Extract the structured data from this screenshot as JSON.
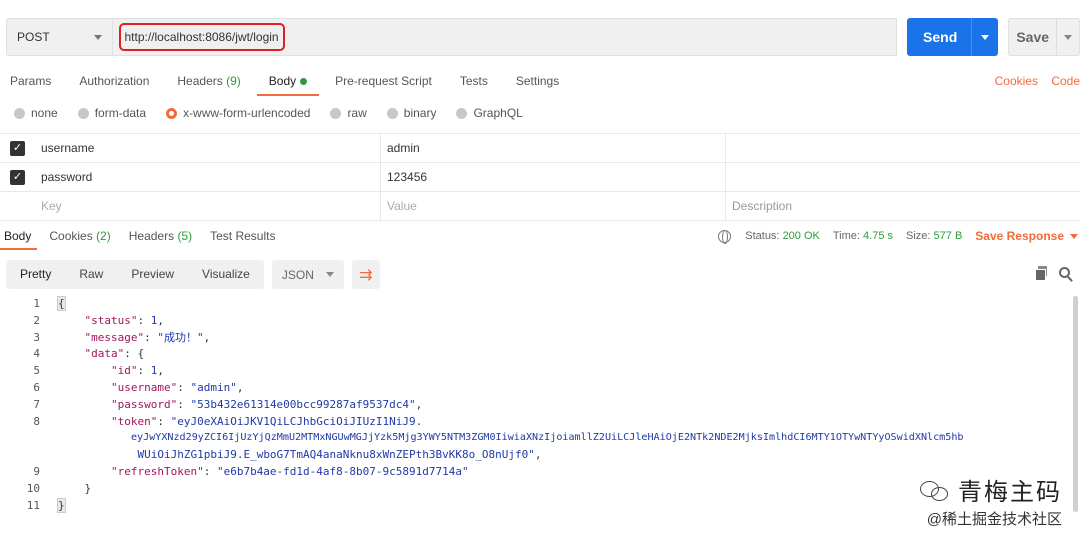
{
  "request": {
    "method": "POST",
    "url": "http://localhost:8086/jwt/login",
    "send_label": "Send",
    "save_label": "Save"
  },
  "request_tabs": {
    "params": "Params",
    "authorization": "Authorization",
    "headers": "Headers",
    "headers_count": "(9)",
    "body": "Body",
    "prerequest": "Pre-request Script",
    "tests": "Tests",
    "settings": "Settings",
    "cookies": "Cookies",
    "code": "Code"
  },
  "body_types": {
    "none": "none",
    "form_data": "form-data",
    "urlencoded": "x-www-form-urlencoded",
    "raw": "raw",
    "binary": "binary",
    "graphql": "GraphQL"
  },
  "params": {
    "rows": [
      {
        "key": "username",
        "value": "admin"
      },
      {
        "key": "password",
        "value": "123456"
      }
    ],
    "placeholder": {
      "key": "Key",
      "value": "Value",
      "description": "Description"
    }
  },
  "response_tabs": {
    "body": "Body",
    "cookies": "Cookies",
    "cookies_count": "(2)",
    "headers": "Headers",
    "headers_count": "(5)",
    "test_results": "Test Results"
  },
  "response_meta": {
    "status_label": "Status:",
    "status": "200 OK",
    "time_label": "Time:",
    "time": "4.75 s",
    "size_label": "Size:",
    "size": "577 B",
    "save_response": "Save Response"
  },
  "response_toolbar": {
    "pretty": "Pretty",
    "raw": "Raw",
    "preview": "Preview",
    "visualize": "Visualize",
    "format": "JSON"
  },
  "code": {
    "status_key": "\"status\"",
    "status_val": "1",
    "message_key": "\"message\"",
    "message_val": "\"成功！\"",
    "data_key": "\"data\"",
    "id_key": "\"id\"",
    "id_val": "1",
    "username_key": "\"username\"",
    "username_val": "\"admin\"",
    "password_key": "\"password\"",
    "password_val": "\"53b432e61314e00bcc99287af9537dc4\"",
    "token_key": "\"token\"",
    "token_val_1": "\"eyJ0eXAiOiJKV1QiLCJhbGciOiJIUzI1NiJ9.",
    "token_val_2": "eyJwYXNzd29yZCI6IjUzYjQzMmU2MTMxNGUwMGJjYzk5Mjg3YWY5NTM3ZGM0IiwiaXNzIjoiamllZ2UiLCJleHAiOjE2NTk2NDE2MjksImlhdCI6MTY1OTYwNTYyOSwidXNlcm5hb",
    "token_val_3": "WUiOiJhZG1pbiJ9.E_wboG7TmAQ4anaNknu8xWnZEPth3BvKK8o_O8nUjf0\"",
    "refresh_key": "\"refreshToken\"",
    "refresh_val": "\"e6b7b4ae-fd1d-4af8-8b07-9c5891d7714a\""
  },
  "watermark": {
    "line1": "青梅主码",
    "line2": "@稀土掘金技术社区"
  },
  "colors": {
    "accent": "#f26b3a",
    "send_blue": "#1a73e8",
    "highlight_red": "#e02020",
    "success_green": "#2a9d3a"
  }
}
